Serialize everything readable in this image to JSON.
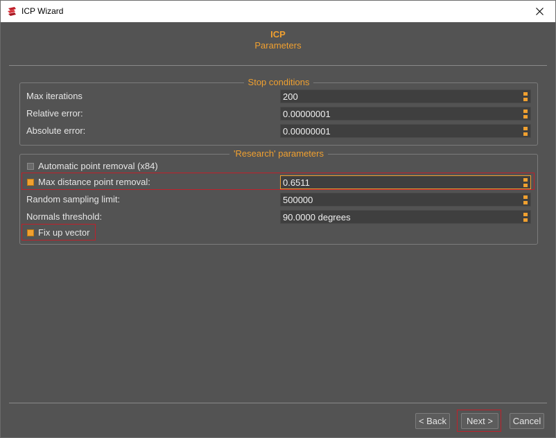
{
  "window": {
    "title": "ICP Wizard"
  },
  "header": {
    "title": "ICP",
    "subtitle": "Parameters"
  },
  "stop_conditions": {
    "title": "Stop conditions",
    "rows": [
      {
        "label": "Max iterations",
        "value": "200"
      },
      {
        "label": "Relative error:",
        "value": "0.00000001"
      },
      {
        "label": "Absolute error:",
        "value": "0.00000001"
      }
    ]
  },
  "research": {
    "title": "'Research' parameters",
    "auto_removal": {
      "label": "Automatic point removal (x84)",
      "checked": false
    },
    "max_distance": {
      "label": "Max distance point removal:",
      "value": "0.6511",
      "checked": true
    },
    "random_sampling": {
      "label": "Random sampling limit:",
      "value": "500000"
    },
    "normals_threshold": {
      "label": "Normals threshold:",
      "value": "90.0000 degrees"
    },
    "fix_up": {
      "label": "Fix up vector",
      "checked": true
    }
  },
  "buttons": {
    "back": "< Back",
    "next": "Next >",
    "cancel": "Cancel"
  },
  "colors": {
    "accent": "#f0a030",
    "background": "#535353",
    "field": "#3f3f3f",
    "highlight": "#c0202a"
  },
  "icons": {
    "app": "cloudcompare-logo-icon",
    "close": "close-icon"
  }
}
